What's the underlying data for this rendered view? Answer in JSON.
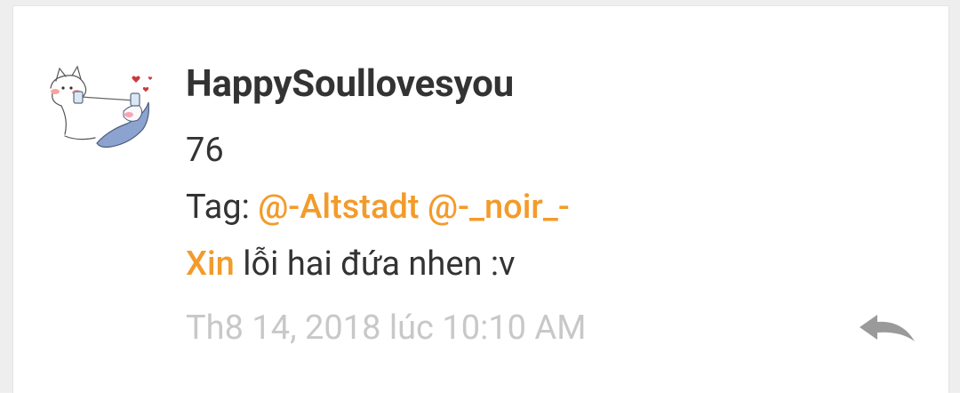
{
  "comment": {
    "username": "HappySoullovesyou",
    "lines": {
      "number": "76",
      "tag_prefix": "Tag: ",
      "mention_1": "@-Altstadt",
      "mention_2": "@-_noir_-",
      "xin": "Xin",
      "apology": " lỗi hai đứa nhen :v"
    },
    "timestamp": "Th8 14, 2018 lúc 10:10 AM"
  },
  "icons": {
    "avatar": "cat-drawing-avatar",
    "reply": "reply-arrow-icon"
  },
  "colors": {
    "mention": "#f39b2a",
    "text": "#333333",
    "timestamp": "#c8c8c8",
    "reply_icon": "#9a9a9a"
  }
}
